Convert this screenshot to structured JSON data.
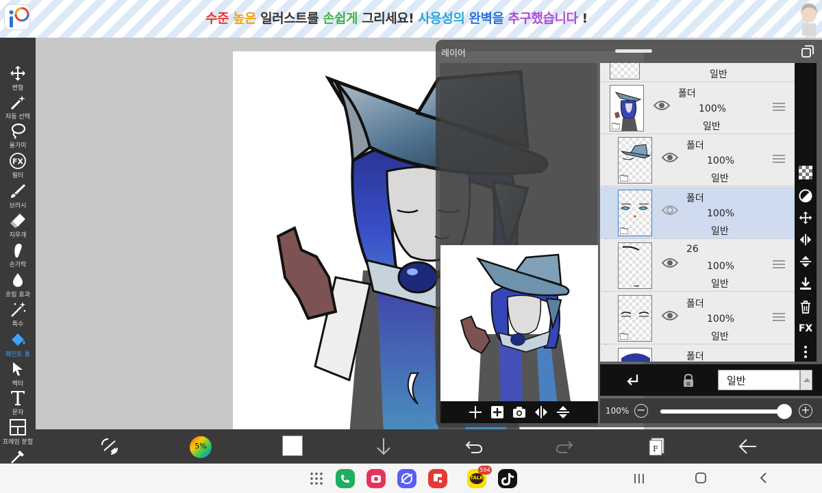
{
  "banner": {
    "segments": [
      {
        "text": "수준 ",
        "color": "#e53935"
      },
      {
        "text": "높은 ",
        "color": "#f2a413"
      },
      {
        "text": "일러스트를 ",
        "color": "#333333"
      },
      {
        "text": "손쉽게 ",
        "color": "#40b24a"
      },
      {
        "text": "그리세요! ",
        "color": "#333333"
      },
      {
        "text": "사용성의 ",
        "color": "#2aa7d8"
      },
      {
        "text": "완벽을 ",
        "color": "#2a73d8"
      },
      {
        "text": "추구했습니다",
        "color": "#b04ad8"
      },
      {
        "text": " !",
        "color": "#333333"
      }
    ],
    "logo_icon": "ibis-paint-logo-icon",
    "avatar_icon": "ad-character-avatar"
  },
  "toolbar": {
    "tools": [
      {
        "name": "transform",
        "label": "변형",
        "icon": "move-arrows-icon"
      },
      {
        "name": "magic-wand",
        "label": "자동 선택",
        "icon": "magic-wand-icon"
      },
      {
        "name": "lasso",
        "label": "올가미",
        "icon": "lasso-icon"
      },
      {
        "name": "filter",
        "label": "필터",
        "icon": "fx-icon"
      },
      {
        "name": "brush",
        "label": "브러시",
        "icon": "brush-icon"
      },
      {
        "name": "eraser",
        "label": "지우개",
        "icon": "eraser-icon"
      },
      {
        "name": "smudge",
        "label": "손가락",
        "icon": "finger-icon"
      },
      {
        "name": "blur",
        "label": "흐림 효과",
        "icon": "drop-icon"
      },
      {
        "name": "special",
        "label": "특수",
        "icon": "sparkle-wand-icon"
      },
      {
        "name": "fill",
        "label": "페인트 통",
        "icon": "paint-bucket-icon"
      },
      {
        "name": "vector",
        "label": "벡터",
        "icon": "cursor-arrow-icon"
      },
      {
        "name": "text",
        "label": "문자",
        "icon": "text-t-icon"
      },
      {
        "name": "frame-divider",
        "label": "프레임 분할",
        "icon": "frame-divider-icon"
      }
    ],
    "active": "fill"
  },
  "bottom_bar": {
    "color_wheel_label": "5%",
    "current_color": "#ffffff",
    "icons": [
      "transform-quick-icon",
      "color-wheel-icon",
      "current-color-swatch",
      "download-arrow-icon",
      "undo-icon",
      "redo-icon",
      "layer-button-icon",
      "back-arrow-icon"
    ],
    "layer_button_label": "F"
  },
  "layer_panel": {
    "title": "레이어",
    "top_partial_blend": "일반",
    "layers": [
      {
        "name": "폴더",
        "opacity": "100%",
        "blend": "일반",
        "is_folder": true,
        "selected": false
      },
      {
        "name": "폴더",
        "opacity": "100%",
        "blend": "일반",
        "is_folder": true,
        "selected": false
      },
      {
        "name": "폴더",
        "opacity": "100%",
        "blend": "일반",
        "is_folder": true,
        "selected": true
      },
      {
        "name": "26",
        "opacity": "100%",
        "blend": "일반",
        "is_folder": false,
        "selected": false
      },
      {
        "name": "폴더",
        "opacity": "100%",
        "blend": "일반",
        "is_folder": true,
        "selected": false
      },
      {
        "name": "폴더",
        "opacity": "",
        "blend": "",
        "is_folder": true,
        "selected": false
      }
    ],
    "side_tools": [
      "checker-icon",
      "half-circle-icon",
      "move-arrows-icon",
      "flip-horizontal-icon",
      "flip-vertical-icon",
      "merge-down-icon",
      "trash-icon",
      "fx-label",
      "more-vertical-icon"
    ],
    "side_fx_label": "FX",
    "blend_mode": "일반",
    "opacity_label": "100%",
    "opacity_value": 1.0,
    "preview_tools": [
      "add-layer-icon",
      "add-folder-icon",
      "camera-icon",
      "flip-h-icon",
      "flip-v-icon"
    ]
  },
  "navbar": {
    "apps": [
      {
        "name": "apps-grid-icon",
        "color": "#666666"
      },
      {
        "name": "phone-app-icon",
        "color": "#1fae62"
      },
      {
        "name": "camera-app-icon",
        "color": "#e5345c"
      },
      {
        "name": "browser-app-icon",
        "color": "#5a5ef2"
      },
      {
        "name": "flipboard-app-icon",
        "color": "#e53935"
      },
      {
        "name": "kakaotalk-app-icon",
        "color": "#f9e000"
      },
      {
        "name": "tiktok-app-icon",
        "color": "#111111"
      }
    ],
    "kakao_badge": "594",
    "kakao_label": "TALK",
    "system_buttons": [
      "recent-apps-icon",
      "home-icon",
      "back-icon"
    ]
  }
}
